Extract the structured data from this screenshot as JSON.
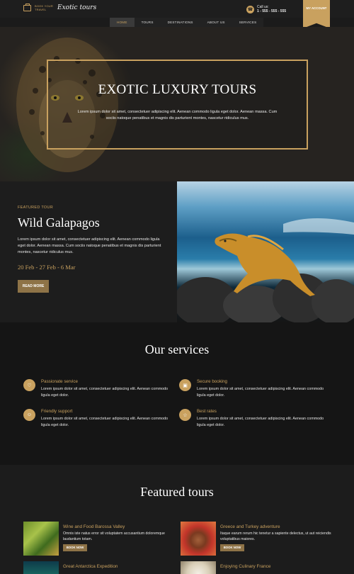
{
  "header": {
    "book_label": "BOOK YOUR TRAVEL",
    "logo": "Exotic tours",
    "call_label": "Call us:",
    "phone": "1 - 555 - 555 - 555",
    "account_label": "MY ACCOUNT"
  },
  "nav": {
    "items": [
      {
        "label": "HOME"
      },
      {
        "label": "TOURS"
      },
      {
        "label": "DESTINATIONS"
      },
      {
        "label": "ABOUT US"
      },
      {
        "label": "SERVICES"
      }
    ]
  },
  "hero": {
    "title": "EXOTIC LUXURY TOURS",
    "text": "Lorem ipsum dolor sit amet, consectetuer adipiscing elit. Aenean commodo ligula eget dolor. Aenean massa. Cum sociis natoque penatibus et magnis dis parturient montes, nascetur ridiculus mus."
  },
  "featured": {
    "label": "FEATURED TOUR",
    "title": "Wild Galapagos",
    "description": "Lorem ipsum dolor sit amet, consectetuer adipiscing elit. Aenean commodo ligula eget dolor. Aenean massa. Cum sociis natoque penatibus et magnis dis parturient montes, nascetur ridiculus mus.",
    "dates": "20 Feb - 27 Feb - 6 Mar",
    "button": "READ MORE"
  },
  "services": {
    "title": "Our services",
    "items": [
      {
        "title": "Passionate service",
        "text": "Lorem ipsum dolor sit amet, consectetuer adipiscing elit. Aenean commodo ligula eget dolor.",
        "icon": "heart-icon"
      },
      {
        "title": "Secure booking",
        "text": "Lorem ipsum dolor sit amet, consectetuer adipiscing elit. Aenean commodo ligula eget dolor.",
        "icon": "calendar-icon"
      },
      {
        "title": "Friendly support",
        "text": "Lorem ipsum dolor sit amet, consectetuer adipiscing elit. Aenean commodo ligula eget dolor.",
        "icon": "smiley-icon"
      },
      {
        "title": "Best rates",
        "text": "Lorem ipsum dolor sit amet, consectetuer adipiscing elit. Aenean commodo ligula eget dolor.",
        "icon": "star-icon"
      }
    ]
  },
  "tours": {
    "title": "Featured tours",
    "items": [
      {
        "title": "Wine and Food Barossa Valley",
        "text": "Omnis iste natus error sit voluptatem accusantium doloremque laudantium totam.",
        "button": "BOOK NOW"
      },
      {
        "title": "Greece and Turkey adventure",
        "text": "Itaque earum rerum hic tenetur a sapiente delectus, ut aut reiciendis voluptatibus maiores.",
        "button": "BOOK NOW"
      },
      {
        "title": "Great Antarctica Expedition",
        "text": "",
        "button": ""
      },
      {
        "title": "Enjoying Culinary France",
        "text": "",
        "button": ""
      }
    ]
  },
  "colors": {
    "accent": "#c9a15f",
    "background": "#1b1b1b",
    "button": "#8e7347"
  }
}
